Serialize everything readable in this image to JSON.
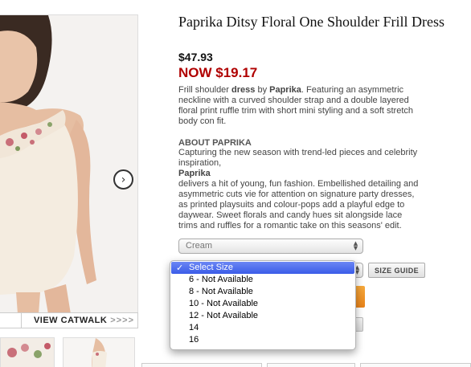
{
  "product": {
    "title": "Paprika Ditsy Floral One Shoulder Frill Dress",
    "old_price": "$47.93",
    "now_price": "NOW $19.17",
    "description_parts": {
      "p1": "Frill shoulder ",
      "b1": "dress",
      "p2": " by ",
      "b2": "Paprika",
      "p3": ". Featuring an asymmetric neckline with a curved shoulder strap and a double layered floral print ruffle trim with short mini styling and a soft stretch body con fit."
    },
    "about": {
      "heading": "ABOUT PAPRIKA",
      "intro": "Capturing the new season with trend-led pieces and celebrity inspiration,",
      "brand": "Paprika",
      "body": "delivers a hit of young, fun fashion. Embellished detailing and asymmetric cuts vie for attention on signature party dresses, as printed playsuits and colour-pops add a playful edge to daywear. Sweet florals and candy hues sit alongside lace trims and ruffles for a romantic take on this seasons' edit."
    }
  },
  "gallery": {
    "view_catwalk_label": "VIEW CATWALK",
    "arrows": ">>>>",
    "next_icon": "chevron-right-circle-icon",
    "next_glyph": "›"
  },
  "colour_select": {
    "value": "Cream",
    "stepper_glyph": "▲▼"
  },
  "size_guide_label": "SIZE GUIDE",
  "size_dropdown": {
    "check_glyph": "✓",
    "options": [
      {
        "label": "Select Size",
        "selected": true
      },
      {
        "label": "6 - Not Available",
        "selected": false
      },
      {
        "label": "8 - Not Available",
        "selected": false
      },
      {
        "label": "10 - Not Available",
        "selected": false
      },
      {
        "label": "12 - Not Available",
        "selected": false
      },
      {
        "label": "14",
        "selected": false
      },
      {
        "label": "16",
        "selected": false
      }
    ]
  },
  "colors": {
    "now_price": "#b00000",
    "selected_option": "#3a5ce8",
    "add_to_bag": "#e8831a"
  }
}
